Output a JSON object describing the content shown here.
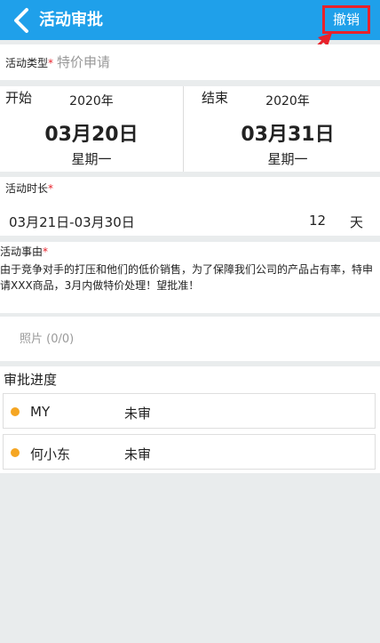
{
  "header": {
    "title": "活动审批",
    "cancel_label": "撤销",
    "accent": "#1fa0ea",
    "highlight": "#e8222b",
    "back_icon": "chevron-left-icon"
  },
  "activity_type": {
    "label": "活动类型",
    "required_mark": "*",
    "value": "特价申请"
  },
  "dates": {
    "start": {
      "label": "开始",
      "year": "2020年",
      "date": "03月20日",
      "weekday": "星期一"
    },
    "end": {
      "label": "结束",
      "year": "2020年",
      "date": "03月31日",
      "weekday": "星期一"
    }
  },
  "duration": {
    "label": "活动时长",
    "required_mark": "*",
    "range": "03月21日-03月30日",
    "days": "12",
    "unit": "天"
  },
  "reason": {
    "label": "活动事由",
    "required_mark": "*",
    "text": "由于竞争对手的打压和他们的低价销售，为了保障我们公司的产品占有率，特申请XXX商品，3月内做特价处理！望批准！"
  },
  "photos": {
    "label": "照片 (0/0)"
  },
  "approval": {
    "title": "审批进度",
    "dot_color": "#f5a623",
    "approvers": [
      {
        "name": "MY",
        "status": "未审"
      },
      {
        "name": "何小东",
        "status": "未审"
      }
    ]
  }
}
